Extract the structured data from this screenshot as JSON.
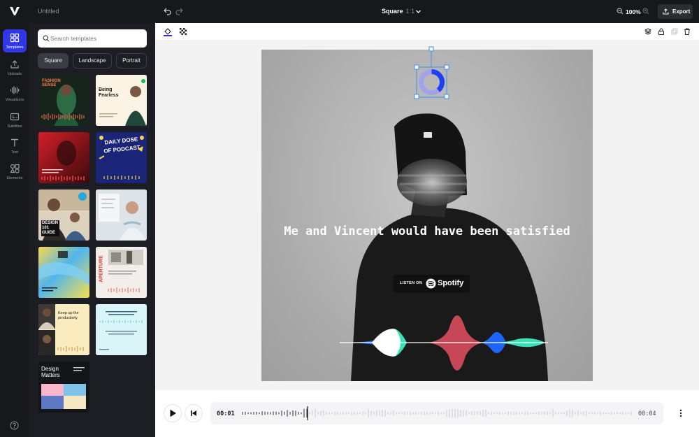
{
  "app": {
    "document_title": "Untitled"
  },
  "header": {
    "format": "Square",
    "format_ratio": "1:1",
    "zoom": "100%",
    "export_label": "Export"
  },
  "rail": {
    "items": [
      {
        "label": "Templates",
        "icon": "grid-icon",
        "active": true
      },
      {
        "label": "Uploads",
        "icon": "upload-icon",
        "active": false
      },
      {
        "label": "Visualizers",
        "icon": "waveform-icon",
        "active": false
      },
      {
        "label": "Subtitles",
        "icon": "subtitles-icon",
        "active": false
      },
      {
        "label": "Text",
        "icon": "text-icon",
        "active": false
      },
      {
        "label": "Elements",
        "icon": "shapes-icon",
        "active": false
      }
    ]
  },
  "templates": {
    "search_placeholder": "Search templates",
    "tabs": [
      "Square",
      "Landscape",
      "Portrait"
    ],
    "active_tab": "Square",
    "cards": [
      {
        "id": "fashion-sense",
        "text": "FASHION SENSE"
      },
      {
        "id": "being-fearless",
        "text": "Being Fearless"
      },
      {
        "id": "red-portrait",
        "text": ""
      },
      {
        "id": "daily-dose",
        "text": "DAILY DOSE OF PODCAST"
      },
      {
        "id": "design-101",
        "text": "DESIGN 101 GUIDE"
      },
      {
        "id": "whiteboard",
        "text": ""
      },
      {
        "id": "gradient-abstract",
        "text": ""
      },
      {
        "id": "aperture",
        "text": "APERTURE"
      },
      {
        "id": "keep-up",
        "text": "Keep up the productivity"
      },
      {
        "id": "cyan-quote",
        "text": ""
      },
      {
        "id": "design-matters",
        "text": "Design Matters"
      }
    ]
  },
  "canvas": {
    "caption": "Me and Vincent would have been satisfied",
    "spotify_listen": "LISTEN ON",
    "spotify_brand": "Spotify"
  },
  "timeline": {
    "current_time": "00:01",
    "total_time": "00:04",
    "progress": 0.25
  },
  "colors": {
    "accent": "#2f37e8",
    "dark_chrome": "#17181c",
    "panel": "#1d1e23"
  }
}
